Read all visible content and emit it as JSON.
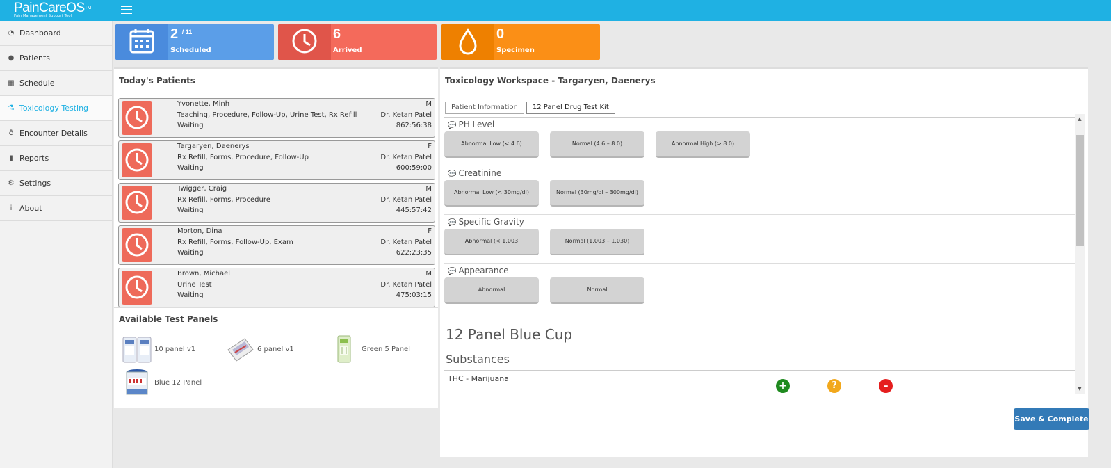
{
  "app": {
    "brand": "PainCareOS",
    "trademark": "TM",
    "tagline": "Pain Management Support Tool"
  },
  "sidebar": {
    "items": [
      {
        "label": "Dashboard",
        "icon": "dashboard-icon"
      },
      {
        "label": "Patients",
        "icon": "users-icon"
      },
      {
        "label": "Schedule",
        "icon": "calendar-icon"
      },
      {
        "label": "Toxicology Testing",
        "icon": "flask-icon",
        "active": true
      },
      {
        "label": "Encounter Details",
        "icon": "stethoscope-icon"
      },
      {
        "label": "Reports",
        "icon": "bar-chart-icon"
      },
      {
        "label": "Settings",
        "icon": "gears-icon"
      },
      {
        "label": "About",
        "icon": "info-icon"
      }
    ]
  },
  "stats": {
    "scheduled": {
      "value": "2",
      "total": "/ 11",
      "label": "Scheduled",
      "color": "#5b9ee8"
    },
    "arrived": {
      "value": "6",
      "label": "Arrived",
      "color": "#f46a5b"
    },
    "specimen": {
      "value": "0",
      "label": "Specimen",
      "color": "#fb8f16"
    }
  },
  "todays_patients": {
    "title": "Today's Patients",
    "patients": [
      {
        "name": "Yvonette, Minh",
        "sex": "M",
        "reasons": "Teaching, Procedure, Follow-Up, Urine Test, Rx Refill",
        "doctor": "Dr. Ketan Patel",
        "status": "Waiting",
        "wait": "862:56:38"
      },
      {
        "name": "Targaryen, Daenerys",
        "sex": "F",
        "reasons": "Rx Refill, Forms, Procedure, Follow-Up",
        "doctor": "Dr. Ketan Patel",
        "status": "Waiting",
        "wait": "600:59:00"
      },
      {
        "name": "Twigger, Craig",
        "sex": "M",
        "reasons": "Rx Refill, Forms, Procedure",
        "doctor": "Dr. Ketan Patel",
        "status": "Waiting",
        "wait": "445:57:42"
      },
      {
        "name": "Morton, Dina",
        "sex": "F",
        "reasons": "Rx Refill, Forms, Follow-Up, Exam",
        "doctor": "Dr. Ketan Patel",
        "status": "Waiting",
        "wait": "622:23:35"
      },
      {
        "name": "Brown, Michael",
        "sex": "M",
        "reasons": "Urine Test",
        "doctor": "Dr. Ketan Patel",
        "status": "Waiting",
        "wait": "475:03:15"
      }
    ]
  },
  "test_panels": {
    "title": "Available Test Panels",
    "items": [
      {
        "label": "10 panel v1"
      },
      {
        "label": "6 panel v1"
      },
      {
        "label": "Green 5 Panel"
      },
      {
        "label": "Blue 12 Panel"
      }
    ]
  },
  "workspace": {
    "title": "Toxicology Workspace - Targaryen, Daenerys",
    "tabs": [
      {
        "label": "Patient Information",
        "active": false
      },
      {
        "label": "12 Panel Drug Test Kit",
        "active": true
      }
    ],
    "sections": [
      {
        "title": "PH Level",
        "options": [
          "Abnormal Low (< 4.6)",
          "Normal (4.6 – 8.0)",
          "Abnormal High (> 8.0)"
        ]
      },
      {
        "title": "Creatinine",
        "options": [
          "Abnormal Low (< 30mg/dl)",
          "Normal (30mg/dl – 300mg/dl)"
        ]
      },
      {
        "title": "Specific Gravity",
        "options": [
          "Abnormal (< 1.003",
          "Normal (1.003 – 1.030)"
        ]
      },
      {
        "title": "Appearance",
        "options": [
          "Abnormal",
          "Normal"
        ]
      }
    ],
    "kit_title": "12 Panel Blue Cup",
    "substances_title": "Substances",
    "substances": [
      {
        "name": "THC - Marijuana"
      }
    ],
    "result_icons": {
      "positive": "+",
      "unknown": "?",
      "negative": "–"
    },
    "save_label": "Save & Complete"
  }
}
